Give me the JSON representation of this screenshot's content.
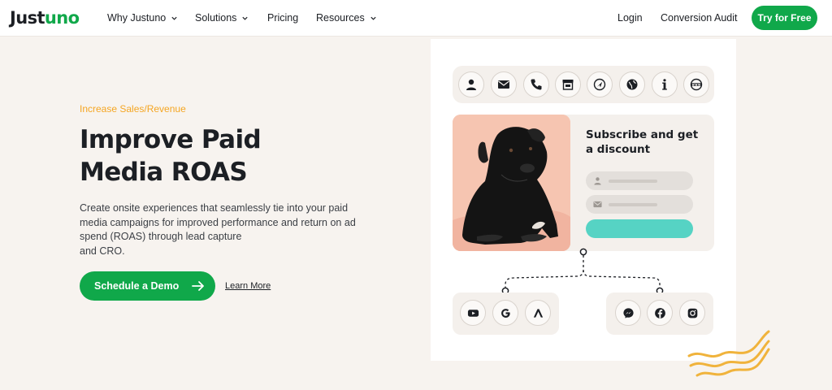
{
  "nav": {
    "logo_main": "Just",
    "logo_accent": "uno",
    "items": [
      {
        "label": "Why Justuno",
        "dropdown": true
      },
      {
        "label": "Solutions",
        "dropdown": true
      },
      {
        "label": "Pricing",
        "dropdown": false
      },
      {
        "label": "Resources",
        "dropdown": true
      }
    ],
    "login": "Login",
    "audit": "Conversion Audit",
    "cta": "Try for Free"
  },
  "hero": {
    "eyebrow": "Increase Sales/Revenue",
    "headline_line1": "Improve Paid",
    "headline_line2": "Media ROAS",
    "paragraph_line1": "Create onsite experiences that seamlessly tie into your paid",
    "paragraph_line2": "media campaigns for improved performance and return on ad",
    "paragraph_line3": "spend (ROAS) through lead capture",
    "paragraph_line4": "and CRO.",
    "primary_button": "Schedule a Demo",
    "secondary_link": "Learn More"
  },
  "illustration": {
    "top_icons": [
      "user-icon",
      "mail-icon",
      "phone-icon",
      "store-icon",
      "location-arrow-icon",
      "globe-icon",
      "info-icon",
      "www-icon"
    ],
    "subscribe_title": "Subscribe and get a discount",
    "left_social_icons": [
      "youtube-icon",
      "google-icon",
      "adroll-icon"
    ],
    "right_social_icons": [
      "messenger-icon",
      "facebook-icon",
      "instagram-icon"
    ]
  },
  "colors": {
    "brand_green": "#10a84a",
    "accent_orange": "#f5a623",
    "accent_teal": "#56d3c4",
    "page_bg": "#f7f3ef"
  }
}
